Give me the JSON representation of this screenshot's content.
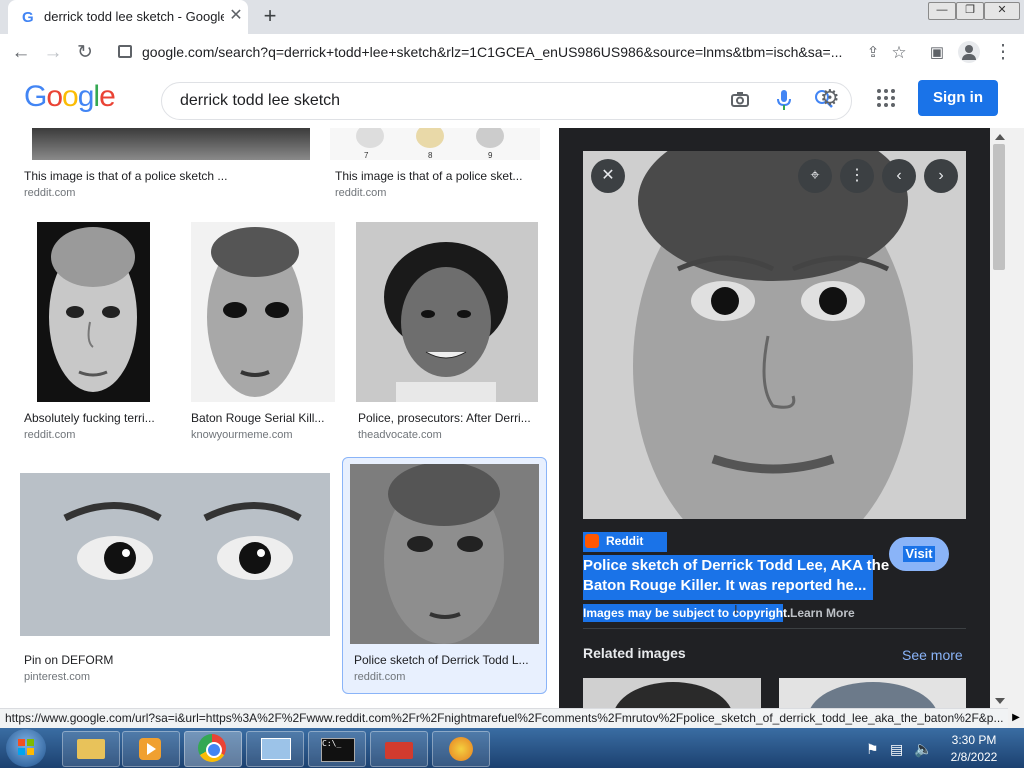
{
  "browser": {
    "tab_title": "derrick todd lee sketch - Google",
    "tab_favicon": "G",
    "url": "google.com/search?q=derrick+todd+lee+sketch&rlz=1C1GCEA_enUS986US986&source=lnms&tbm=isch&sa=..."
  },
  "google": {
    "logo_letters": [
      "G",
      "o",
      "o",
      "g",
      "l",
      "e"
    ],
    "logo_colors": [
      "#4285f4",
      "#ea4335",
      "#fbbc05",
      "#4285f4",
      "#34a853",
      "#ea4335"
    ],
    "query": "derrick todd lee sketch",
    "sign_in": "Sign in"
  },
  "results": [
    {
      "caption": "This image is that of a police sketch ...",
      "source": "reddit.com"
    },
    {
      "caption": "This image is that of a police sket...",
      "source": "reddit.com"
    },
    {
      "caption": "Absolutely fucking terri...",
      "source": "reddit.com"
    },
    {
      "caption": "Baton Rouge Serial Kill...",
      "source": "knowyourmeme.com"
    },
    {
      "caption": "Police, prosecutors: After Derri...",
      "source": "theadvocate.com"
    },
    {
      "caption": "Pin on DEFORM",
      "source": "pinterest.com"
    },
    {
      "caption": "Police sketch of Derrick Todd L...",
      "source": "reddit.com"
    }
  ],
  "panel": {
    "site_name": "Reddit",
    "title_line1": "Police sketch of Derrick Todd Lee, AKA the",
    "title_line2": "Baton Rouge Killer. It was reported he...",
    "copyright": "Images may be subject to copyright.",
    "learn_more": "Learn More",
    "visit": "Visit",
    "related_heading": "Related images",
    "see_more": "See more"
  },
  "status_url": "https://www.google.com/url?sa=i&url=https%3A%2F%2Fwww.reddit.com%2Fr%2Fnightmarefuel%2Fcomments%2Fmrutov%2Fpolice_sketch_of_derrick_todd_lee_aka_the_baton%2F&p...",
  "taskbar": {
    "time": "3:30 PM",
    "date": "2/8/2022"
  },
  "colors": {
    "accent": "#1a73e8",
    "panel_bg": "#202124",
    "selection": "#1a73e8"
  }
}
